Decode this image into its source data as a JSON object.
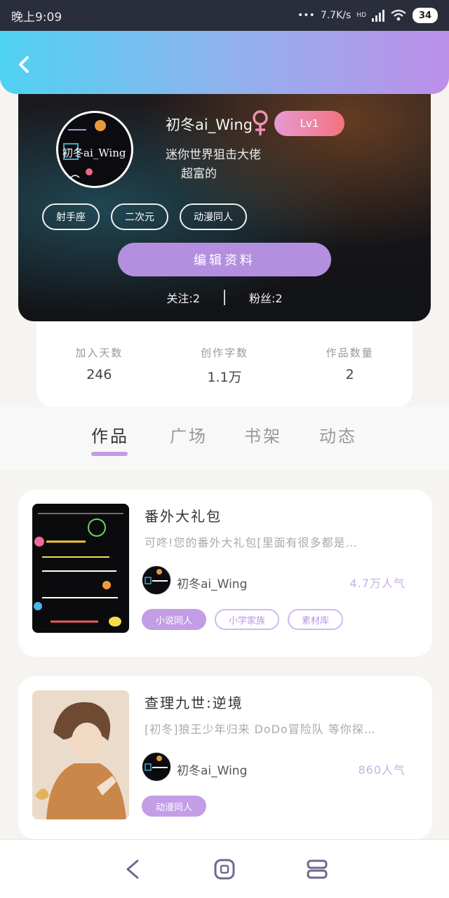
{
  "status_bar": {
    "time": "晚上9:09",
    "network_speed": "7.7K/s",
    "hd_label": "HD",
    "battery": "34"
  },
  "profile": {
    "avatar_text": "初冬ai_Wing",
    "username": "初冬ai_Wing",
    "level": "Lv1",
    "signature_line1": "迷你世界狙击大佬",
    "signature_line2": "超富的",
    "tags": [
      "射手座",
      "二次元",
      "动漫同人"
    ],
    "edit_button": "编辑资料",
    "following": "关注:2",
    "followers": "粉丝:2"
  },
  "stats": [
    {
      "label": "加入天数",
      "value": "246"
    },
    {
      "label": "创作字数",
      "value": "1.1万"
    },
    {
      "label": "作品数量",
      "value": "2"
    }
  ],
  "tabs": [
    "作品",
    "广场",
    "书架",
    "动态"
  ],
  "active_tab": "作品",
  "works": [
    {
      "title": "番外大礼包",
      "description": "可咚!您的番外大礼包[里面有很多都是…",
      "author": "初冬ai_Wing",
      "popularity": "4.7万人气",
      "tags": [
        "小说同人",
        "小学家族",
        "素材库"
      ]
    },
    {
      "title": "查理九世:逆境",
      "description": "[初冬]狼王少年归来 DoDo冒险队 等你探…",
      "author": "初冬ai_Wing",
      "popularity": "860人气",
      "tags": [
        "动漫同人"
      ]
    }
  ],
  "colors": {
    "accent": "#b48fe0",
    "header_start": "#4fd2f2",
    "header_end": "#bd8fe8",
    "level_badge": "#f2737f"
  }
}
